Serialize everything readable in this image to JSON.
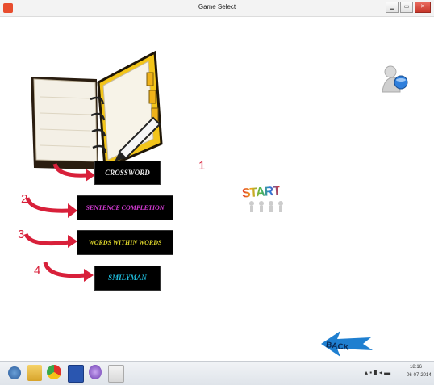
{
  "window": {
    "title": "Game Select",
    "minimize": "▁",
    "maximize": "▭",
    "close": "✕"
  },
  "games": [
    {
      "label": "CROSSWORD",
      "number": "1",
      "color": "#e8e8e8"
    },
    {
      "label": "SENTENCE COMPLETION",
      "number": "2",
      "color": "#d63bd6"
    },
    {
      "label": "WORDS WITHIN WORDS",
      "number": "3",
      "color": "#d8d02a"
    },
    {
      "label": "SMILYMAN",
      "number": "4",
      "color": "#1fc0e0"
    }
  ],
  "start_label": "START",
  "back_label": "BACK",
  "taskbar": {
    "icons": [
      "start-orb-icon",
      "file-explorer-icon",
      "chrome-icon",
      "word-icon",
      "media-icon",
      "java-icon"
    ],
    "time": "18:16",
    "date": "06-07-2014"
  }
}
